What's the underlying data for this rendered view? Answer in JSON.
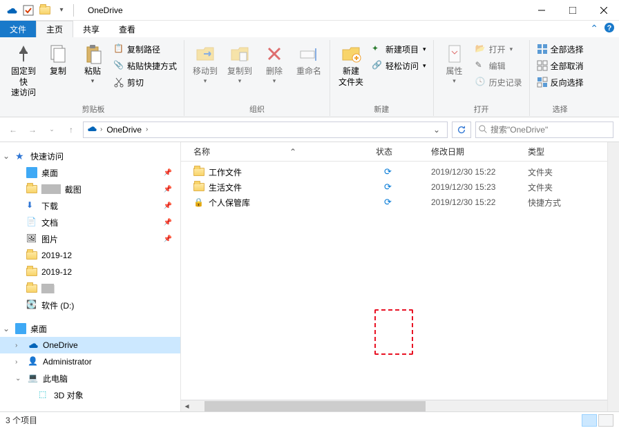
{
  "title": "OneDrive",
  "tabs": {
    "file": "文件",
    "home": "主页",
    "share": "共享",
    "view": "查看"
  },
  "ribbon": {
    "pin": "固定到快\n速访问",
    "copy": "复制",
    "paste": "粘贴",
    "copypath": "复制路径",
    "paste_shortcut": "粘贴快捷方式",
    "cut": "剪切",
    "group_clipboard": "剪贴板",
    "moveto": "移动到",
    "copyto": "复制到",
    "delete": "删除",
    "rename": "重命名",
    "group_organize": "组织",
    "newfolder": "新建\n文件夹",
    "newitem": "新建项目",
    "easyaccess": "轻松访问",
    "group_new": "新建",
    "properties": "属性",
    "open": "打开",
    "edit": "编辑",
    "history": "历史记录",
    "group_open": "打开",
    "selectall": "全部选择",
    "selectnone": "全部取消",
    "invertsel": "反向选择",
    "group_select": "选择"
  },
  "address": {
    "location": "OneDrive"
  },
  "search": {
    "placeholder": "搜索\"OneDrive\""
  },
  "sidebar": {
    "quickaccess": "快速访问",
    "desktop": "桌面",
    "screenshots_suffix": "截图",
    "downloads": "下载",
    "documents": "文档",
    "pictures": "图片",
    "folder_2019_12a": "2019-12",
    "folder_2019_12b": "2019-12",
    "redacted": "",
    "softd": "软件 (D:)",
    "desktop2": "桌面",
    "onedrive": "OneDrive",
    "admin": "Administrator",
    "thispc": "此电脑",
    "objects3d": "3D 对象"
  },
  "columns": {
    "name": "名称",
    "state": "状态",
    "date": "修改日期",
    "type": "类型"
  },
  "files": [
    {
      "name": "工作文件",
      "date": "2019/12/30 15:22",
      "type": "文件夹",
      "icon": "folder"
    },
    {
      "name": "生活文件",
      "date": "2019/12/30 15:23",
      "type": "文件夹",
      "icon": "folder"
    },
    {
      "name": "个人保管库",
      "date": "2019/12/30 15:22",
      "type": "快捷方式",
      "icon": "vault"
    }
  ],
  "status": {
    "itemcount": "3 个项目"
  }
}
